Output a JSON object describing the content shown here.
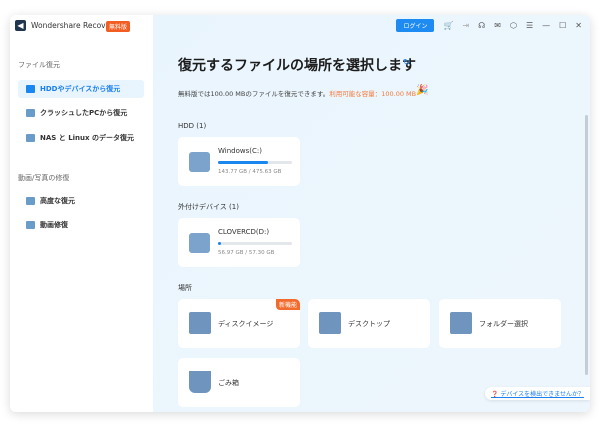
{
  "app": {
    "name": "Wondershare Recoverit",
    "badge": "無料版"
  },
  "topbar": {
    "login": "ログイン",
    "icons": [
      "cart-icon",
      "sign-in-icon",
      "headset-icon",
      "mail-icon",
      "shield-icon",
      "menu-icon",
      "minimize-icon",
      "maximize-icon",
      "close-icon"
    ]
  },
  "sidebar": {
    "section1": "ファイル復元",
    "items1": [
      {
        "label": "HDDやデバイスから復元",
        "active": true
      },
      {
        "label": "クラッシュしたPCから復元"
      },
      {
        "label": "NAS と Linux のデータ復元"
      }
    ],
    "section2": "動画/写真の修復",
    "items2": [
      {
        "label": "高度な復元"
      },
      {
        "label": "動画修復"
      }
    ]
  },
  "main": {
    "title": "復元するファイルの場所を選択します",
    "subtitle": "無料版では100.00 MBのファイルを復元できます。",
    "capacity": "利用可能な容量：100.00 MB",
    "hdd_label": "HDD (1)",
    "ext_label": "外付けデバイス (1)",
    "loc_label": "場所",
    "drives": [
      {
        "name": "Windows(C:)",
        "size": "143.77 GB / 475.63 GB",
        "used_pct": 30.2
      },
      {
        "name": "CLOVERCD(D:)",
        "size": "56.97 GB / 57.30 GB",
        "used_pct": 4
      }
    ],
    "locations": [
      {
        "name": "ディスクイメージ",
        "badge": "新機能"
      },
      {
        "name": "デスクトップ"
      },
      {
        "name": "フォルダー選択"
      },
      {
        "name": "ごみ箱"
      }
    ],
    "help": "デバイスを検出できませんか？"
  },
  "colors": {
    "accent": "#1a86f0",
    "orange": "#f26a2c"
  }
}
